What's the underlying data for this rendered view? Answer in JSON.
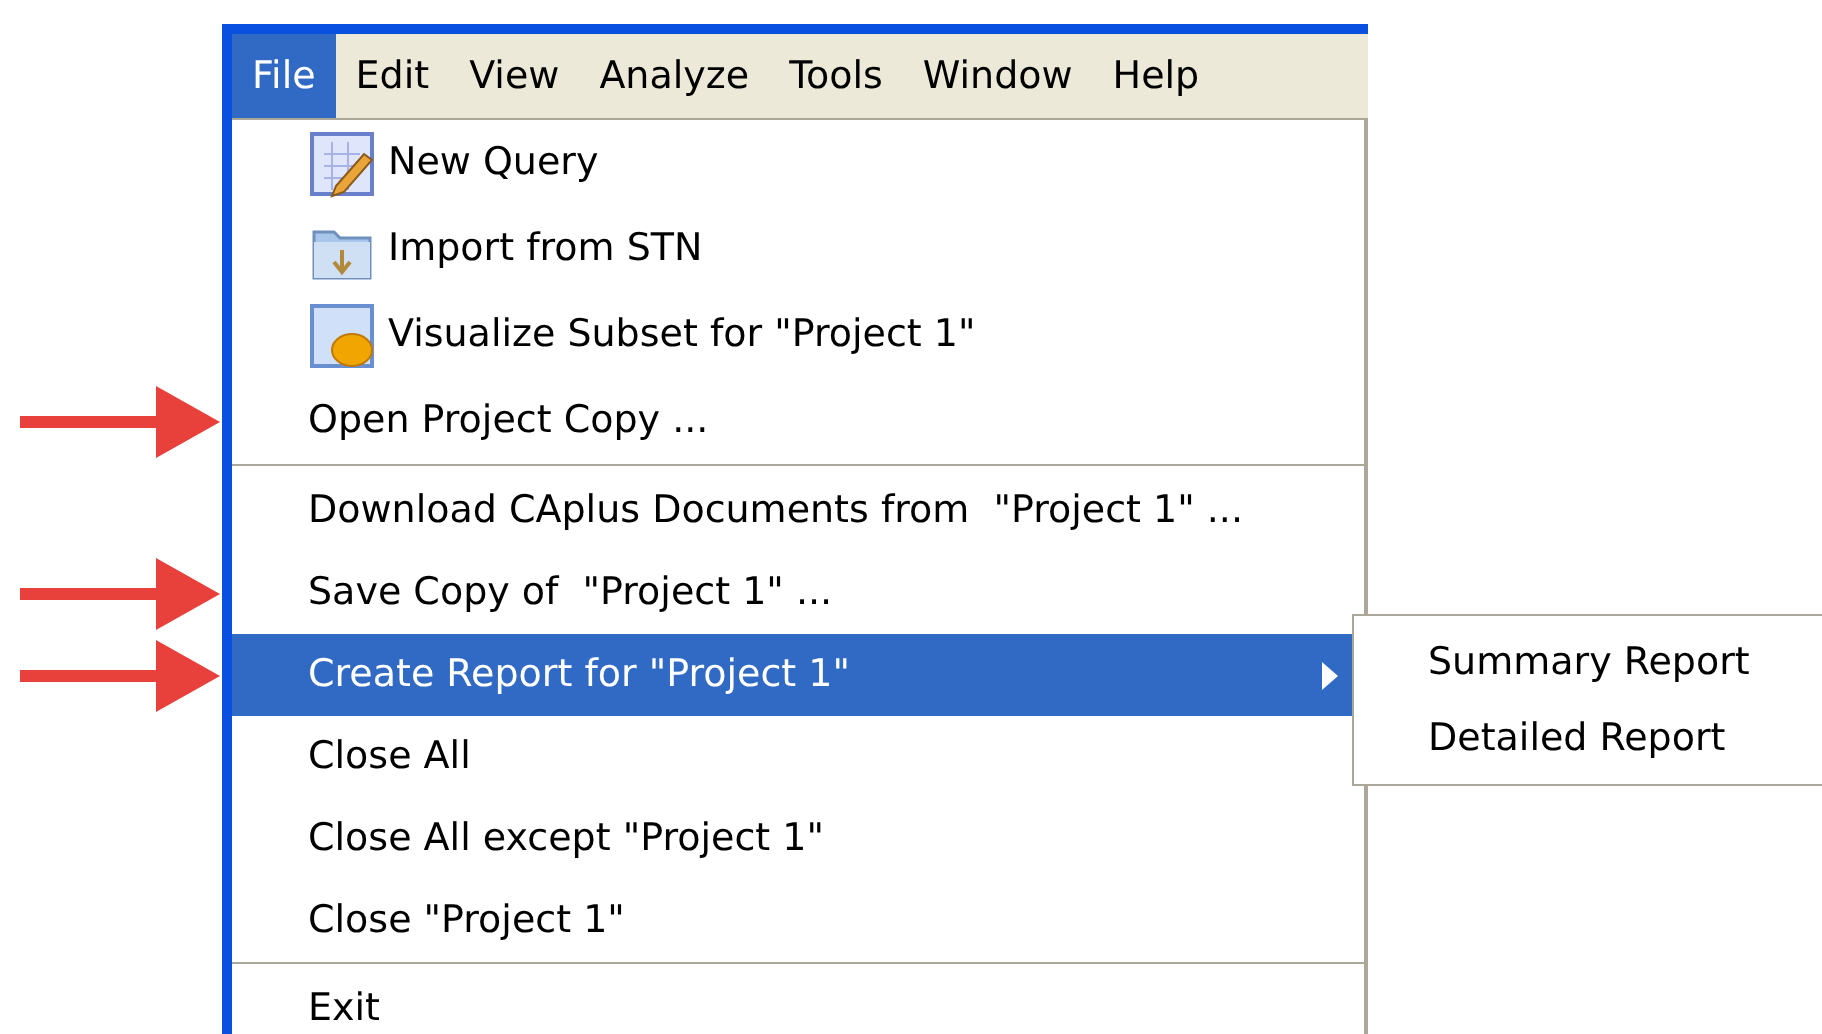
{
  "menu_bar": [
    {
      "label": "File",
      "selected": true
    },
    {
      "label": "Edit",
      "selected": false
    },
    {
      "label": "View",
      "selected": false
    },
    {
      "label": "Analyze",
      "selected": false
    },
    {
      "label": "Tools",
      "selected": false
    },
    {
      "label": "Window",
      "selected": false
    },
    {
      "label": "Help",
      "selected": false
    }
  ],
  "menu_groups": [
    [
      {
        "label": "New Query",
        "kind": "query",
        "selected": false,
        "submenu": false,
        "marked": false
      },
      {
        "label": "Import from STN",
        "kind": "folder",
        "selected": false,
        "submenu": false,
        "marked": false
      },
      {
        "label": "Visualize Subset for \"Project 1\"",
        "kind": "visualize",
        "selected": false,
        "submenu": false,
        "marked": false
      },
      {
        "label": "Open Project Copy ...",
        "selected": false,
        "submenu": false,
        "marked": true
      }
    ],
    [
      {
        "label": "Download CAplus Documents from  \"Project 1\" ...",
        "selected": false,
        "submenu": false,
        "marked": false
      },
      {
        "label": "Save Copy of  \"Project 1\" ...",
        "selected": false,
        "submenu": false,
        "marked": true
      },
      {
        "label": "Create Report for \"Project 1\"",
        "selected": true,
        "submenu": true,
        "marked": true
      },
      {
        "label": "Close All",
        "selected": false,
        "submenu": false,
        "marked": false
      },
      {
        "label": "Close All except \"Project 1\"",
        "selected": false,
        "submenu": false,
        "marked": false
      },
      {
        "label": "Close \"Project 1\"",
        "selected": false,
        "submenu": false,
        "marked": false
      }
    ],
    [
      {
        "label": "Exit",
        "selected": false,
        "submenu": false,
        "marked": false
      }
    ]
  ],
  "submenu": [
    {
      "label": "Summary Report"
    },
    {
      "label": "Detailed Report"
    }
  ]
}
